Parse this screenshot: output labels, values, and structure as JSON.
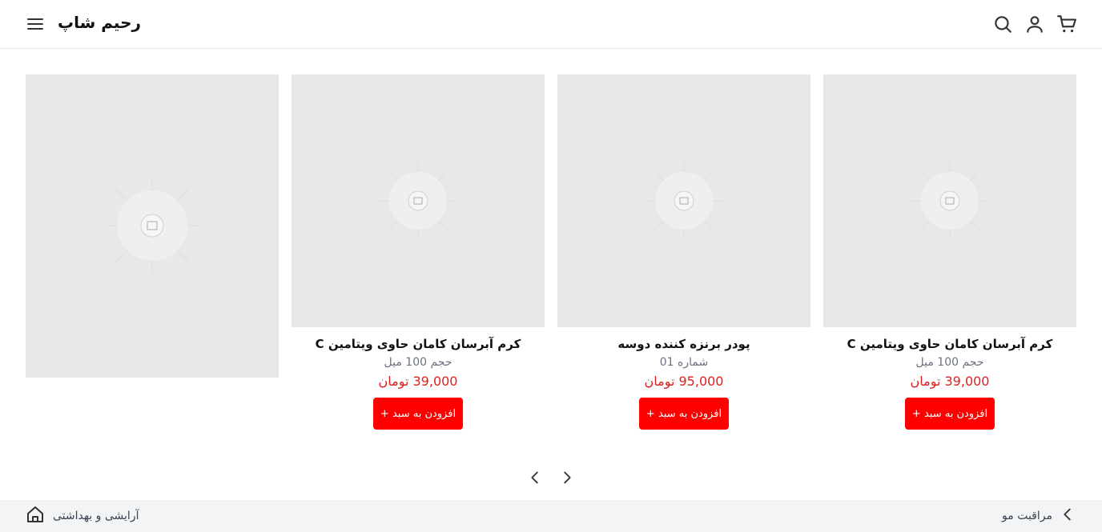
{
  "header": {
    "brand": "رحیم شاپ",
    "icons": [
      "menu-icon",
      "search-icon",
      "user-icon",
      "cart-icon"
    ]
  },
  "products": [
    {
      "title": "کرم آبرسان کامان حاوی ویتامین C",
      "subtitle": "حجم 100 میل",
      "price": "39,000 تومان",
      "button": "افزودن به سبد +"
    },
    {
      "title": "پودر برنزه کننده دوسه",
      "subtitle": "شماره 01",
      "price": "95,000 تومان",
      "button": "افزودن به سبد +"
    },
    {
      "title": "کرم آبرسان کامان حاوی ویتامین C",
      "subtitle": "حجم 100 میل",
      "price": "39,000 تومان",
      "button": "افزودن به سبد +"
    }
  ],
  "pager": {
    "prev_icon": "chevron-left-icon",
    "next_icon": "chevron-right-icon"
  },
  "bottombar": {
    "left_label": "آرایشی و بهداشتی",
    "right_label": "مراقبت مو"
  },
  "colors": {
    "accent": "#ff0000",
    "price": "#e11d1d",
    "placeholder": "#e8e8e8"
  }
}
